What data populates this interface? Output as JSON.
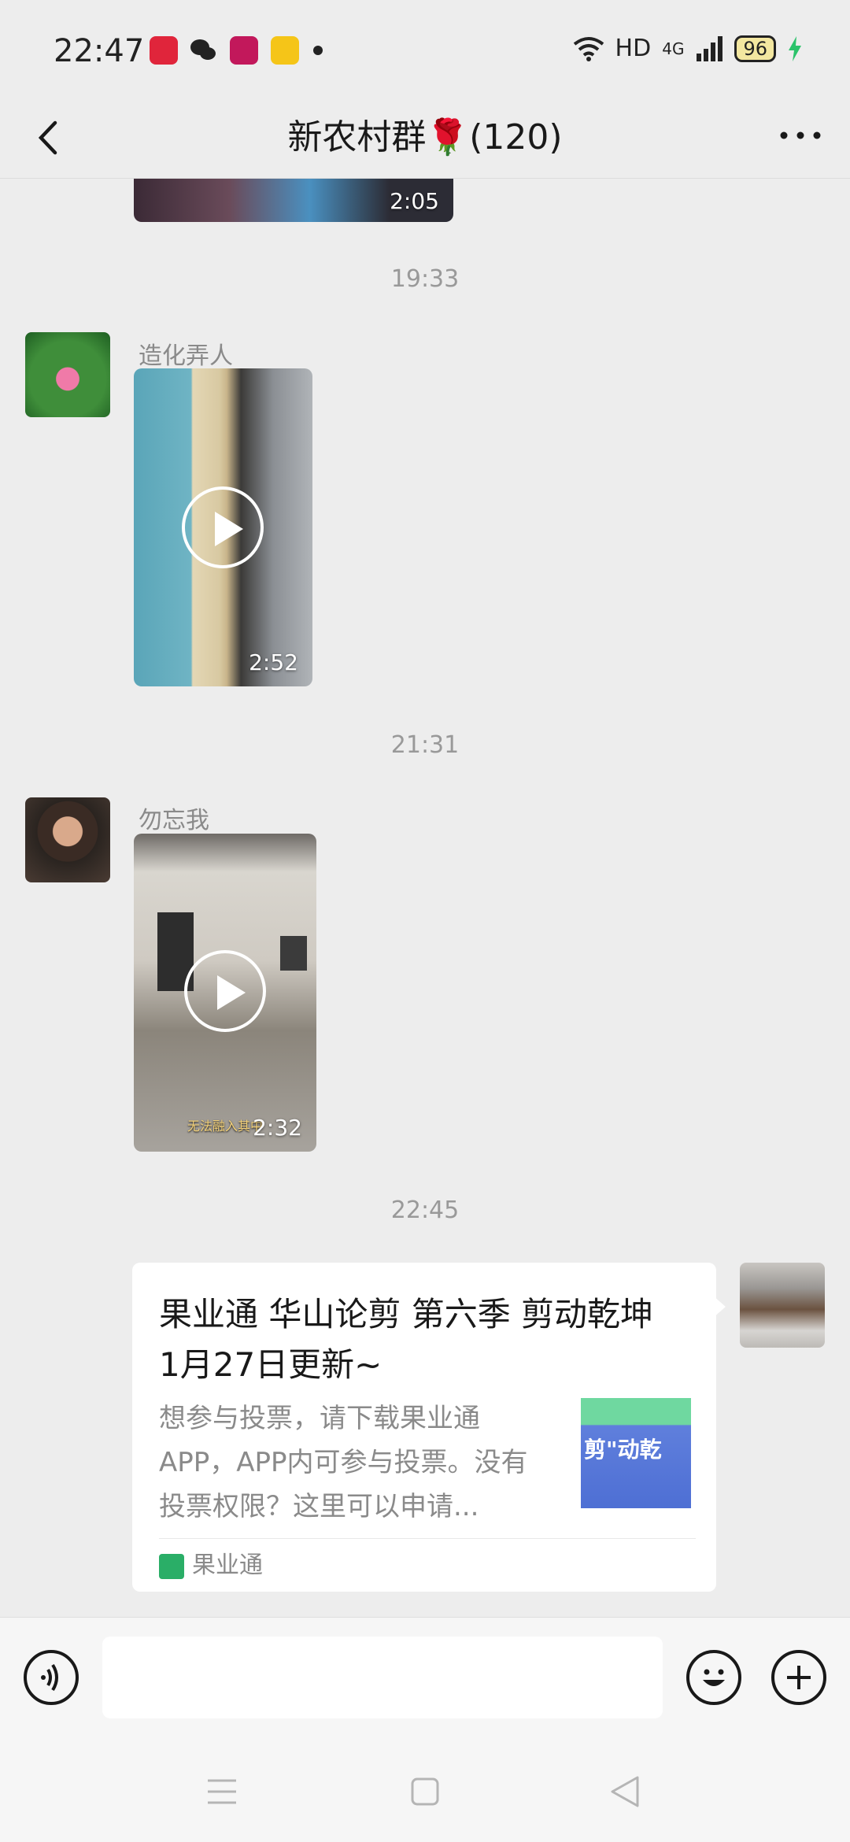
{
  "status_bar": {
    "time": "22:47",
    "network_label": "HD",
    "signal_label": "4G",
    "battery": "96"
  },
  "header": {
    "title": "新农村群🌹(120)"
  },
  "messages": {
    "top_video": {
      "duration": "2:05"
    },
    "ts1": "19:33",
    "msg1": {
      "sender": "造化弄人",
      "duration": "2:52"
    },
    "ts2": "21:31",
    "msg2": {
      "sender": "勿忘我",
      "duration": "2:32",
      "overlay_text": "无法融入其中"
    },
    "ts3": "22:45",
    "card": {
      "title": "果业通 华山论剪 第六季 剪动乾坤 1月27日更新~",
      "description": "想参与投票，请下载果业通APP，APP内可参与投票。没有投票权限？这里可以申请...",
      "source": "果业通",
      "thumb_text": "剪\"动乾"
    }
  },
  "colors": {
    "background": "#ededed",
    "card": "#ffffff",
    "accent_green": "#2aae67"
  }
}
